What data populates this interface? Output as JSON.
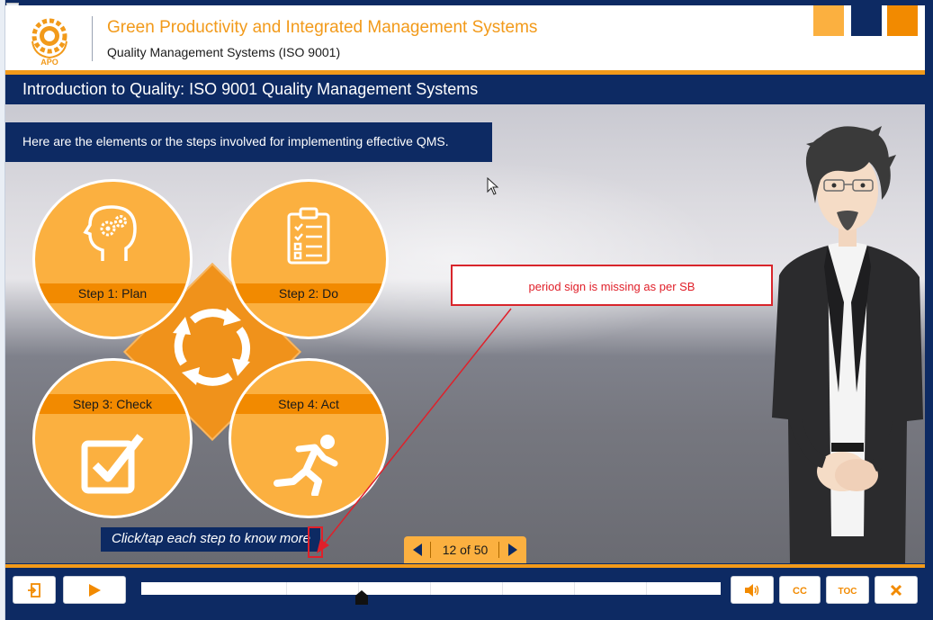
{
  "header": {
    "brand_title": "Green Productivity and Integrated Management Systems",
    "brand_subtitle": "Quality Management Systems (ISO 9001)",
    "logo_text": "APO",
    "accent_orange": "#f29a1a",
    "navy": "#0d2a63"
  },
  "course": {
    "title": "Introduction to Quality: ISO 9001 Quality Management Systems"
  },
  "slide": {
    "intro": "Here are the elements or the steps involved for implementing effective QMS.",
    "steps": [
      {
        "label": "Step 1: Plan",
        "icon": "head-gears-icon"
      },
      {
        "label": "Step 2: Do",
        "icon": "clipboard-checklist-icon"
      },
      {
        "label": "Step 3: Check",
        "icon": "checkbox-icon"
      },
      {
        "label": "Step 4: Act",
        "icon": "running-person-icon"
      }
    ],
    "center_icon": "cycle-arrows-icon",
    "instruction": "Click/tap each step to know more"
  },
  "annotation": {
    "comment": "period sign is missing as per SB",
    "color": "#e0202a"
  },
  "navigation": {
    "page_indicator": "12 of 50",
    "prev_icon": "triangle-left-icon",
    "next_icon": "triangle-right-icon"
  },
  "player_controls": {
    "exit_icon": "exit-icon",
    "play_icon": "play-icon",
    "volume_icon": "volume-icon",
    "cc_label": "CC",
    "toc_label": "TOC",
    "close_icon": "close-icon",
    "progress_fraction": 0.38
  }
}
